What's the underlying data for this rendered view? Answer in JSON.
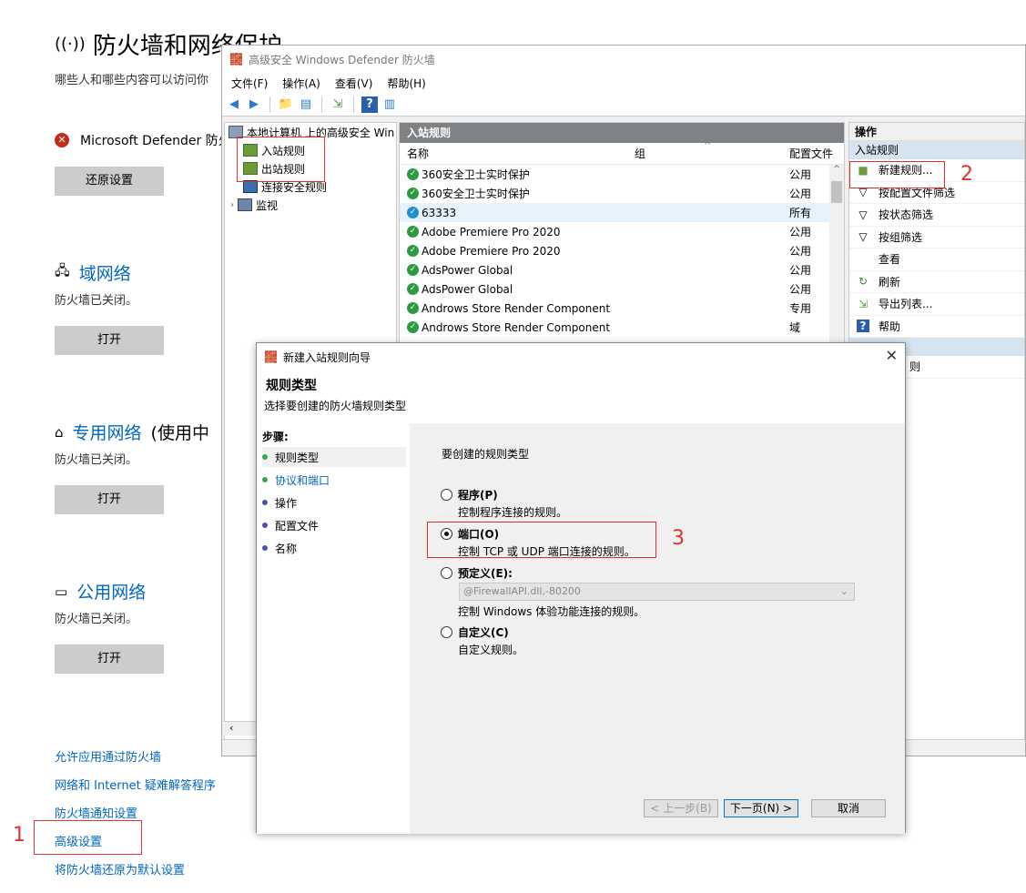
{
  "settings": {
    "title": "防火墙和网络保护",
    "subtitle": "哪些人和哪些内容可以访问你",
    "defender_status": "Microsoft Defender 防火",
    "restore_button": "还原设置",
    "domain_network": {
      "title": "域网络",
      "status": "防火墙已关闭。",
      "button": "打开"
    },
    "private_network": {
      "title": "专用网络",
      "extra": "(使用中",
      "status": "防火墙已关闭。",
      "button": "打开"
    },
    "public_network": {
      "title": "公用网络",
      "status": "防火墙已关闭。",
      "button": "打开"
    },
    "links": [
      "允许应用通过防火墙",
      "网络和 Internet 疑难解答程序",
      "防火墙通知设置",
      "高级设置",
      "将防火墙还原为默认设置"
    ]
  },
  "annotations": {
    "n1": "1",
    "n2": "2",
    "n3": "3"
  },
  "mmc": {
    "title": "高级安全 Windows Defender 防火墙",
    "menu": [
      "文件(F)",
      "操作(A)",
      "查看(V)",
      "帮助(H)"
    ],
    "tree": {
      "root": "本地计算机 上的高级安全 Win",
      "inbound": "入站规则",
      "outbound": "出站规则",
      "connection_security": "连接安全规则",
      "monitor": "监视"
    },
    "center": {
      "header": "入站规则",
      "columns": {
        "name": "名称",
        "group": "组",
        "profile": "配置文件"
      },
      "rules": [
        {
          "name": "360安全卫士实时保护",
          "profile": "公用"
        },
        {
          "name": "360安全卫士实时保护",
          "profile": "公用"
        },
        {
          "name": "63333",
          "profile": "所有"
        },
        {
          "name": "Adobe Premiere Pro 2020",
          "profile": "公用"
        },
        {
          "name": "Adobe Premiere Pro 2020",
          "profile": "公用"
        },
        {
          "name": "AdsPower Global",
          "profile": "公用"
        },
        {
          "name": "AdsPower Global",
          "profile": "公用"
        },
        {
          "name": "Androws Store Render Component",
          "profile": "专用"
        },
        {
          "name": "Androws Store Render Component",
          "profile": "域"
        }
      ]
    },
    "actions": {
      "header": "操作",
      "section": "入站规则",
      "items": [
        "新建规则...",
        "按配置文件筛选",
        "按状态筛选",
        "按组筛选",
        "查看",
        "刷新",
        "导出列表...",
        "帮助"
      ],
      "partial_item": "则"
    }
  },
  "wizard": {
    "title": "新建入站规则向导",
    "heading": "规则类型",
    "description": "选择要创建的防火墙规则类型",
    "steps_label": "步骤:",
    "steps": [
      "规则类型",
      "协议和端口",
      "操作",
      "配置文件",
      "名称"
    ],
    "question": "要创建的规则类型",
    "options": [
      {
        "label": "程序(P)",
        "desc": "控制程序连接的规则。"
      },
      {
        "label": "端口(O)",
        "desc": "控制 TCP 或 UDP 端口连接的规则。"
      },
      {
        "label": "预定义(E):",
        "desc": "控制 Windows 体验功能连接的规则。"
      },
      {
        "label": "自定义(C)",
        "desc": "自定义规则。"
      }
    ],
    "selected_option": "端口(O)",
    "predefined_value": "@FirewallAPI.dll,-80200",
    "buttons": {
      "back": "< 上一步(B)",
      "next": "下一页(N) >",
      "cancel": "取消"
    }
  }
}
